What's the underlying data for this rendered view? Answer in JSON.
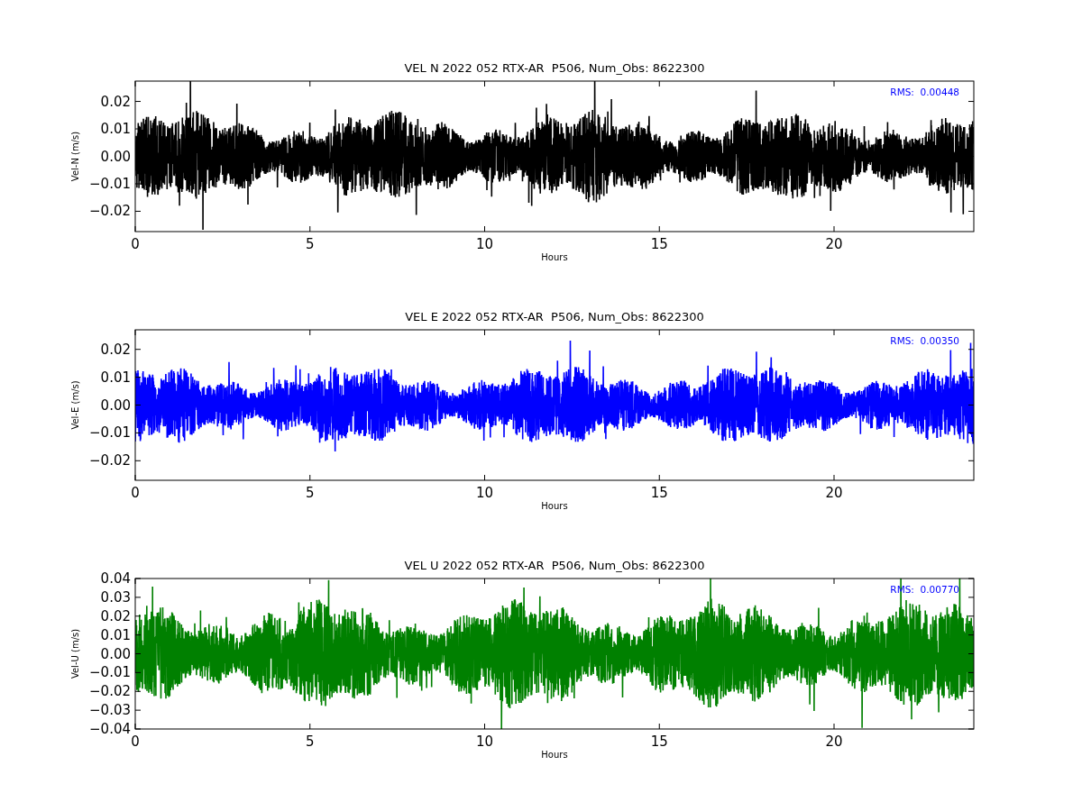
{
  "panels": [
    {
      "title": "VEL N 2022 052 RTX-AR  P506, Num_Obs: 8622300",
      "ylabel": "Vel-N (m/s)",
      "xlabel": "Hours",
      "rms": "RMS:  0.00448",
      "color": "#000000",
      "yticks": [
        "0.02",
        "0.01",
        "0.00",
        "−0.01",
        "−0.02"
      ],
      "xticks": [
        "0",
        "5",
        "10",
        "15",
        "20"
      ]
    },
    {
      "title": "VEL E 2022 052 RTX-AR  P506, Num_Obs: 8622300",
      "ylabel": "Vel-E (m/s)",
      "xlabel": "Hours",
      "rms": "RMS:  0.00350",
      "color": "#0000ff",
      "yticks": [
        "0.02",
        "0.01",
        "0.00",
        "−0.01",
        "−0.02"
      ],
      "xticks": [
        "0",
        "5",
        "10",
        "15",
        "20"
      ]
    },
    {
      "title": "VEL U 2022 052 RTX-AR  P506, Num_Obs: 8622300",
      "ylabel": "Vel-U (m/s)",
      "xlabel": "Hours",
      "rms": "RMS:  0.00770",
      "color": "#008000",
      "yticks": [
        "0.04",
        "0.03",
        "0.02",
        "0.01",
        "0.00",
        "−0.01",
        "−0.02",
        "−0.03",
        "−0.04"
      ],
      "xticks": [
        "0",
        "5",
        "10",
        "15",
        "20"
      ]
    }
  ]
}
